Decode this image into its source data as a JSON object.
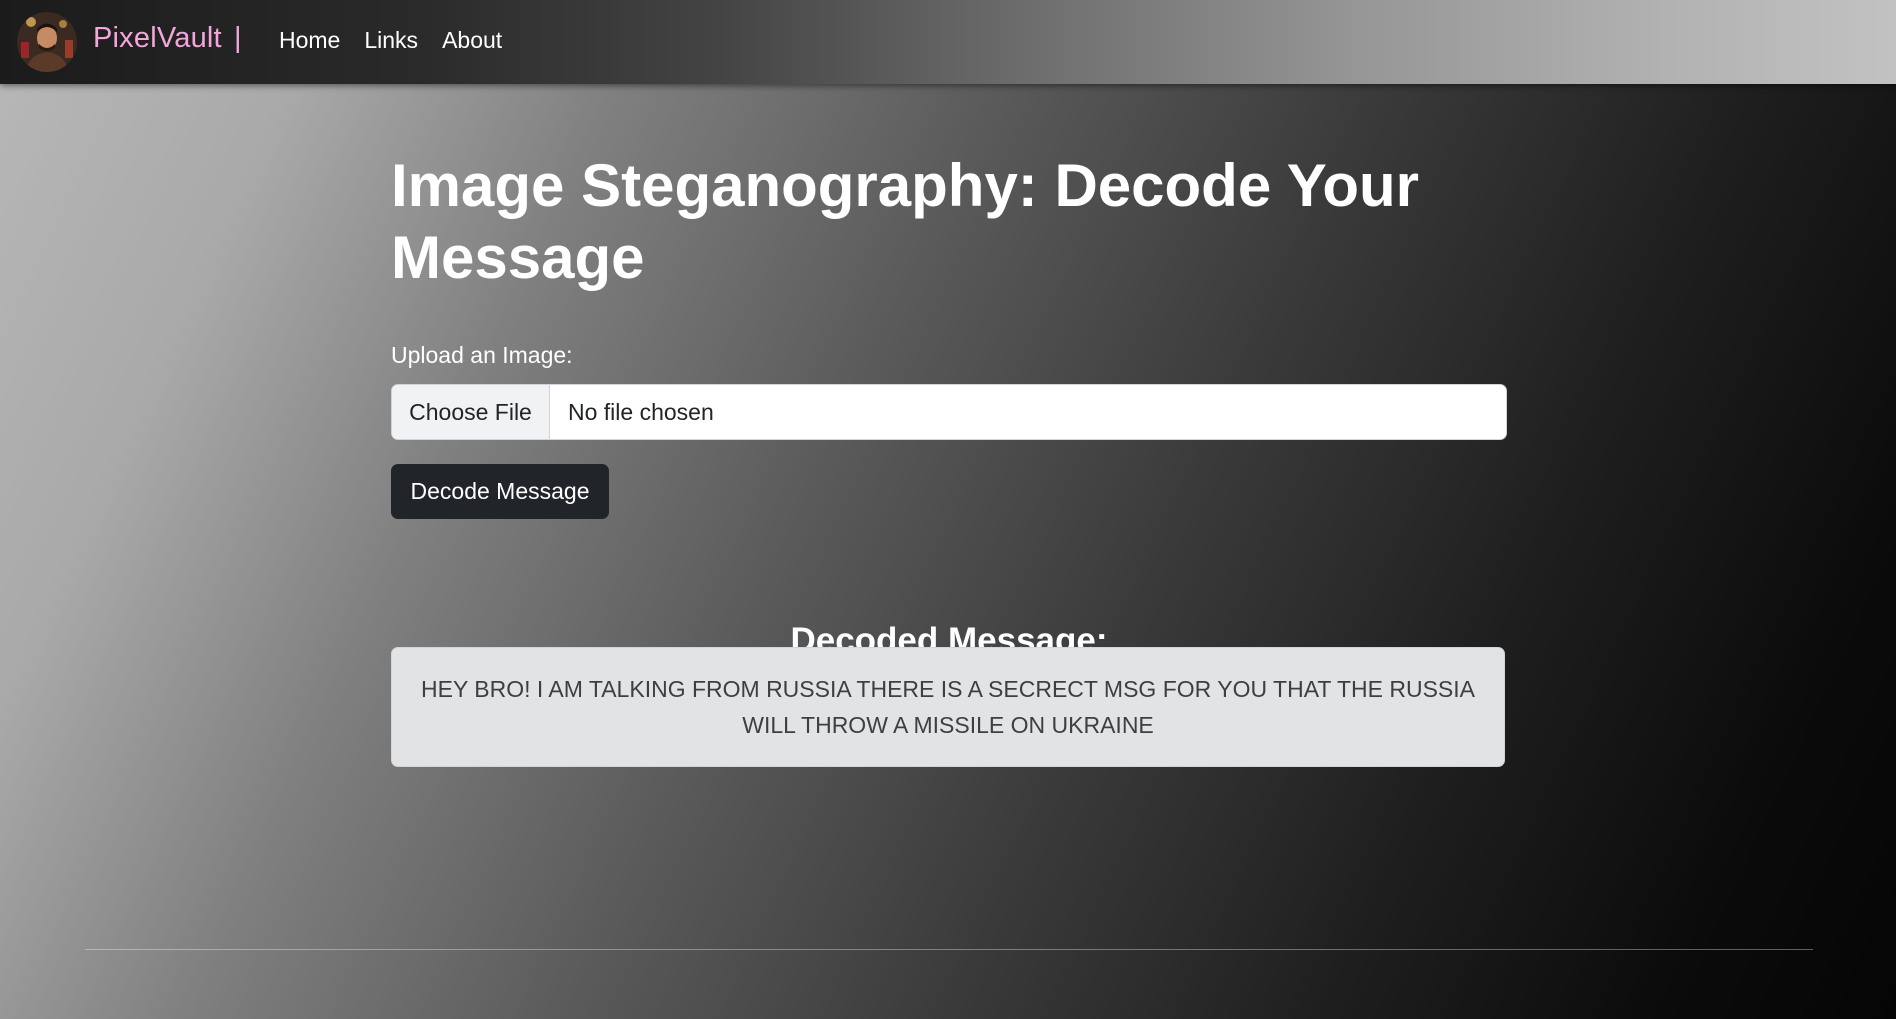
{
  "navbar": {
    "brand": "PixelVault",
    "separator": "|",
    "links": [
      {
        "label": "Home"
      },
      {
        "label": "Links"
      },
      {
        "label": "About"
      }
    ],
    "brand_color": "#f3a6dc"
  },
  "main": {
    "title": "Image Steganography: Decode Your Message",
    "upload_label": "Upload an Image:",
    "file_input": {
      "button_label": "Choose File",
      "status": "No file chosen"
    },
    "decode_button": "Decode Message",
    "decoded_heading": "Decoded Message:",
    "decoded_message": "HEY BRO! I AM TALKING FROM RUSSIA THERE IS A SECRECT MSG FOR YOU THAT THE RUSSIA WILL THROW A MISSILE ON UKRAINE"
  },
  "colors": {
    "button_dark": "#212529",
    "message_bg": "#e2e3e5"
  }
}
